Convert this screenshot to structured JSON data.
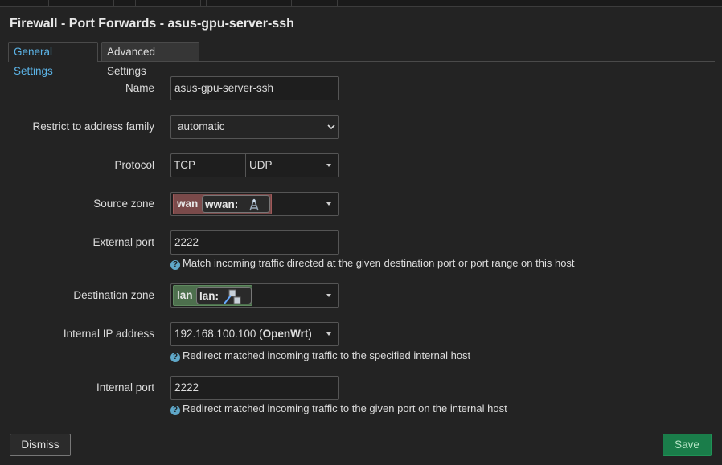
{
  "title": "Firewall - Port Forwards - asus-gpu-server-ssh",
  "tabs": [
    {
      "label": "General Settings",
      "active": true
    },
    {
      "label": "Advanced Settings",
      "active": false
    }
  ],
  "fields": {
    "name": {
      "label": "Name",
      "value": "asus-gpu-server-ssh"
    },
    "family": {
      "label": "Restrict to address family",
      "value": "automatic"
    },
    "protocol": {
      "label": "Protocol",
      "values": [
        "TCP",
        "UDP"
      ]
    },
    "source_zone": {
      "label": "Source zone",
      "zone": "wan",
      "network": "wwan:",
      "zone_color": "#7a4a4a",
      "network_icon": "wireless-antenna-icon"
    },
    "external_port": {
      "label": "External port",
      "value": "2222",
      "help": "Match incoming traffic directed at the given destination port or port range on this host"
    },
    "dest_zone": {
      "label": "Destination zone",
      "zone": "lan",
      "network": "lan:",
      "zone_color": "#4d6f4d",
      "network_icon": "ethernet-wifi-icon"
    },
    "internal_ip": {
      "label": "Internal IP address",
      "value_ip": "192.168.100.100",
      "value_host": "OpenWrt",
      "help": "Redirect matched incoming traffic to the specified internal host"
    },
    "internal_port": {
      "label": "Internal port",
      "value": "2222",
      "help": "Redirect matched incoming traffic to the given port on the internal host"
    }
  },
  "buttons": {
    "dismiss": "Dismiss",
    "save": "Save"
  },
  "colors": {
    "background": "#232323",
    "accent": "#5bb3e6",
    "save": "#1a7d4a"
  }
}
